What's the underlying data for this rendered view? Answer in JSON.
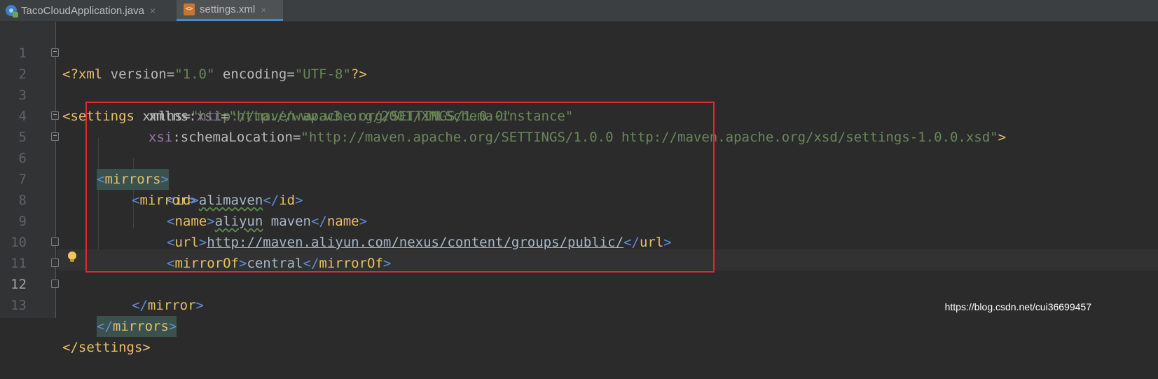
{
  "tabs": [
    {
      "label": "TacoCloudApplication.java",
      "close": "×",
      "icon": "java-class-icon"
    },
    {
      "label": "settings.xml",
      "close": "×",
      "icon": "xml-file-icon",
      "active": true
    }
  ],
  "editor": {
    "lines": [
      {
        "n": "1"
      },
      {
        "n": "2"
      },
      {
        "n": "3"
      },
      {
        "n": "4"
      },
      {
        "n": "5"
      },
      {
        "n": "6"
      },
      {
        "n": "7"
      },
      {
        "n": "8"
      },
      {
        "n": "9"
      },
      {
        "n": "10"
      },
      {
        "n": "11"
      },
      {
        "n": "12"
      },
      {
        "n": "13"
      }
    ],
    "xml_decl": {
      "name": "?xml",
      "a1": "version",
      "v1": "\"1.0\"",
      "a2": "encoding",
      "v2": "\"UTF-8\"",
      "end": "?"
    },
    "settings": {
      "tag": "settings",
      "xmlns_attr": "xmlns",
      "xmlns_val": "\"http://maven.apache.org/SETTINGS/1.0.0\"",
      "xsi_ns": "xmlns",
      "xsi_prefix": "xsi",
      "xsi_val": "\"http://www.w3.org/2001/XMLSchema-instance\"",
      "schema_prefix": "xsi",
      "schema_attr": "schemaLocation",
      "schema_val": "\"http://maven.apache.org/SETTINGS/1.0.0 http://maven.apache.org/xsd/settings-1.0.0.xsd\""
    },
    "mirrors_tag": "mirrors",
    "mirror_tag": "mirror",
    "id_tag": "id",
    "id_value": "alimaven",
    "name_tag": "name",
    "name_value_1": "aliyun",
    "name_value_2": " maven",
    "url_tag": "url",
    "url_value": "http://maven.aliyun.com/nexus/content/groups/public/",
    "mirrorof_tag": "mirrorOf",
    "mirrorof_value": "central"
  },
  "colors": {
    "highlight_box": "#e3282b",
    "background": "#2b2b2b"
  },
  "watermark": "https://blog.csdn.net/cui36699457"
}
